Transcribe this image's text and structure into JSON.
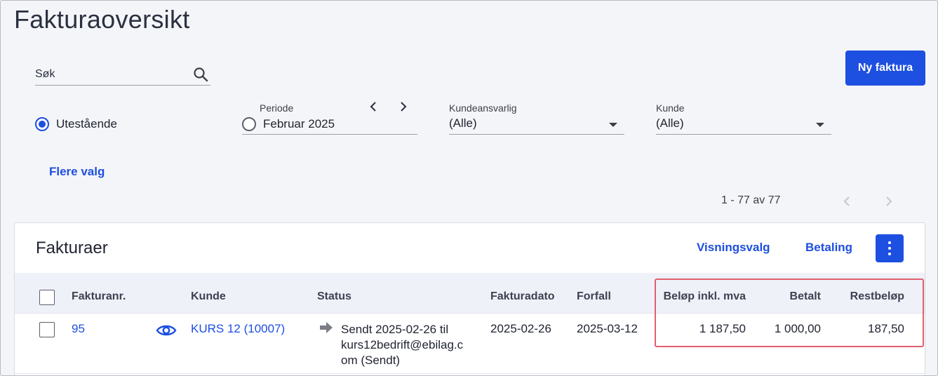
{
  "page": {
    "title": "Fakturaoversikt"
  },
  "search": {
    "placeholder": "Søk",
    "icon": "search-icon"
  },
  "actions": {
    "new_invoice": "Ny faktura"
  },
  "filters": {
    "status_option": "Utestående",
    "periode": {
      "label": "Periode",
      "value": "Februar 2025",
      "prev_icon": "chevron-left-icon",
      "next_icon": "chevron-right-icon"
    },
    "kundeansvarlig": {
      "label": "Kundeansvarlig",
      "value": "(Alle)"
    },
    "kunde": {
      "label": "Kunde",
      "value": "(Alle)"
    },
    "more": "Flere valg"
  },
  "pagination": {
    "text": "1 - 77 av 77"
  },
  "card": {
    "title": "Fakturaer",
    "view_options": "Visningsvalg",
    "payment": "Betaling",
    "menu_icon": "more-vertical-icon"
  },
  "table": {
    "columns": [
      "Fakturanr.",
      "Kunde",
      "Status",
      "Fakturadato",
      "Forfall",
      "Beløp inkl. mva",
      "Betalt",
      "Restbeløp"
    ],
    "rows": [
      {
        "nr": "95",
        "preview_icon": "eye-icon",
        "customer": "KURS 12 (10007)",
        "status_icon": "arrow-right-icon",
        "status_line1": "Sendt 2025-02-26 til",
        "status_line2": "kurs12bedrift@ebilag.c",
        "status_line3": "om (Sendt)",
        "invoice_date": "2025-02-26",
        "due_date": "2025-03-12",
        "amount": "1 187,50",
        "paid": "1 000,00",
        "remaining": "187,50"
      }
    ]
  },
  "colors": {
    "accent": "#1d4fe0",
    "highlight": "#e06070"
  }
}
